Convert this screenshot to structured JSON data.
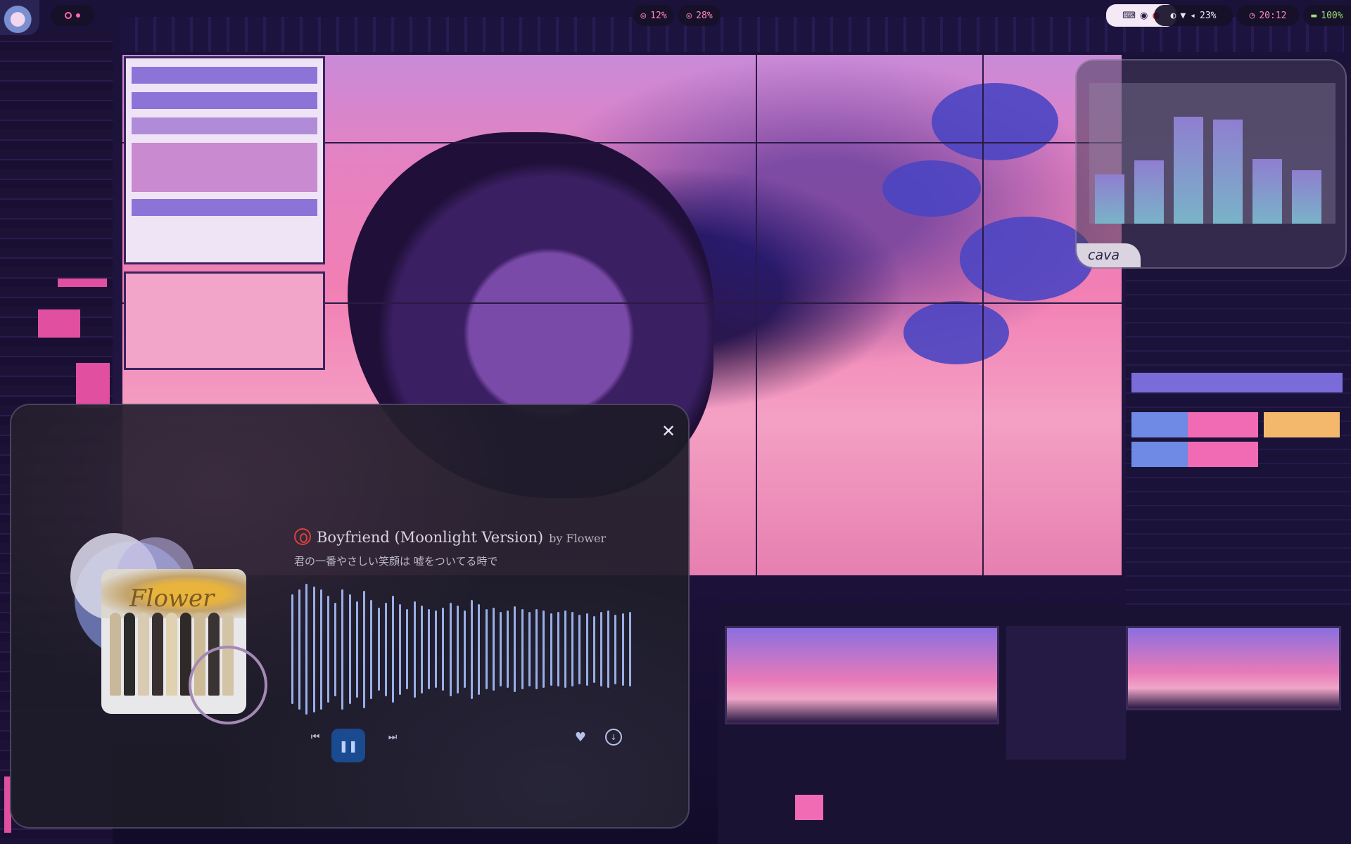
{
  "topbar": {
    "cpu": "12%",
    "mem": "28%",
    "volume": "23%",
    "clock": "20:12",
    "battery": "100%",
    "icons": [
      "keyboard-icon",
      "record-icon",
      "notification-icon",
      "palette-icon",
      "wifi-icon",
      "volume-icon",
      "clock-icon",
      "battery-icon"
    ]
  },
  "cava": {
    "label": "cava",
    "bars": [
      0.35,
      0.45,
      0.76,
      0.74,
      0.46,
      0.38
    ],
    "bar_colors": [
      "#8f7ed0",
      "#79b3c8"
    ]
  },
  "player": {
    "title": "Boyfriend (Moonlight Version)",
    "by_label": "by Flower",
    "lyric": "君の一番やさしい笑顔は 嘘をついてる時で",
    "cover_text": "Flower",
    "status": "playing",
    "icons": {
      "source": "music-source-icon",
      "close": "close-icon",
      "prev": "skip-previous-icon",
      "play": "pause-icon",
      "next": "skip-next-icon",
      "like": "heart-icon",
      "download": "download-icon"
    },
    "waveform": [
      0.82,
      0.9,
      0.98,
      0.94,
      0.9,
      0.8,
      0.7,
      0.9,
      0.82,
      0.72,
      0.88,
      0.74,
      0.62,
      0.7,
      0.8,
      0.68,
      0.6,
      0.72,
      0.66,
      0.6,
      0.58,
      0.62,
      0.7,
      0.66,
      0.58,
      0.74,
      0.68,
      0.6,
      0.62,
      0.56,
      0.58,
      0.64,
      0.6,
      0.56,
      0.6,
      0.58,
      0.54,
      0.56,
      0.58,
      0.56,
      0.52,
      0.54,
      0.5,
      0.56,
      0.58,
      0.52,
      0.54,
      0.56
    ],
    "colors": {
      "accent": "#1a4a8f",
      "wave": "#9aaee6",
      "source_icon": "#d7413a"
    }
  }
}
